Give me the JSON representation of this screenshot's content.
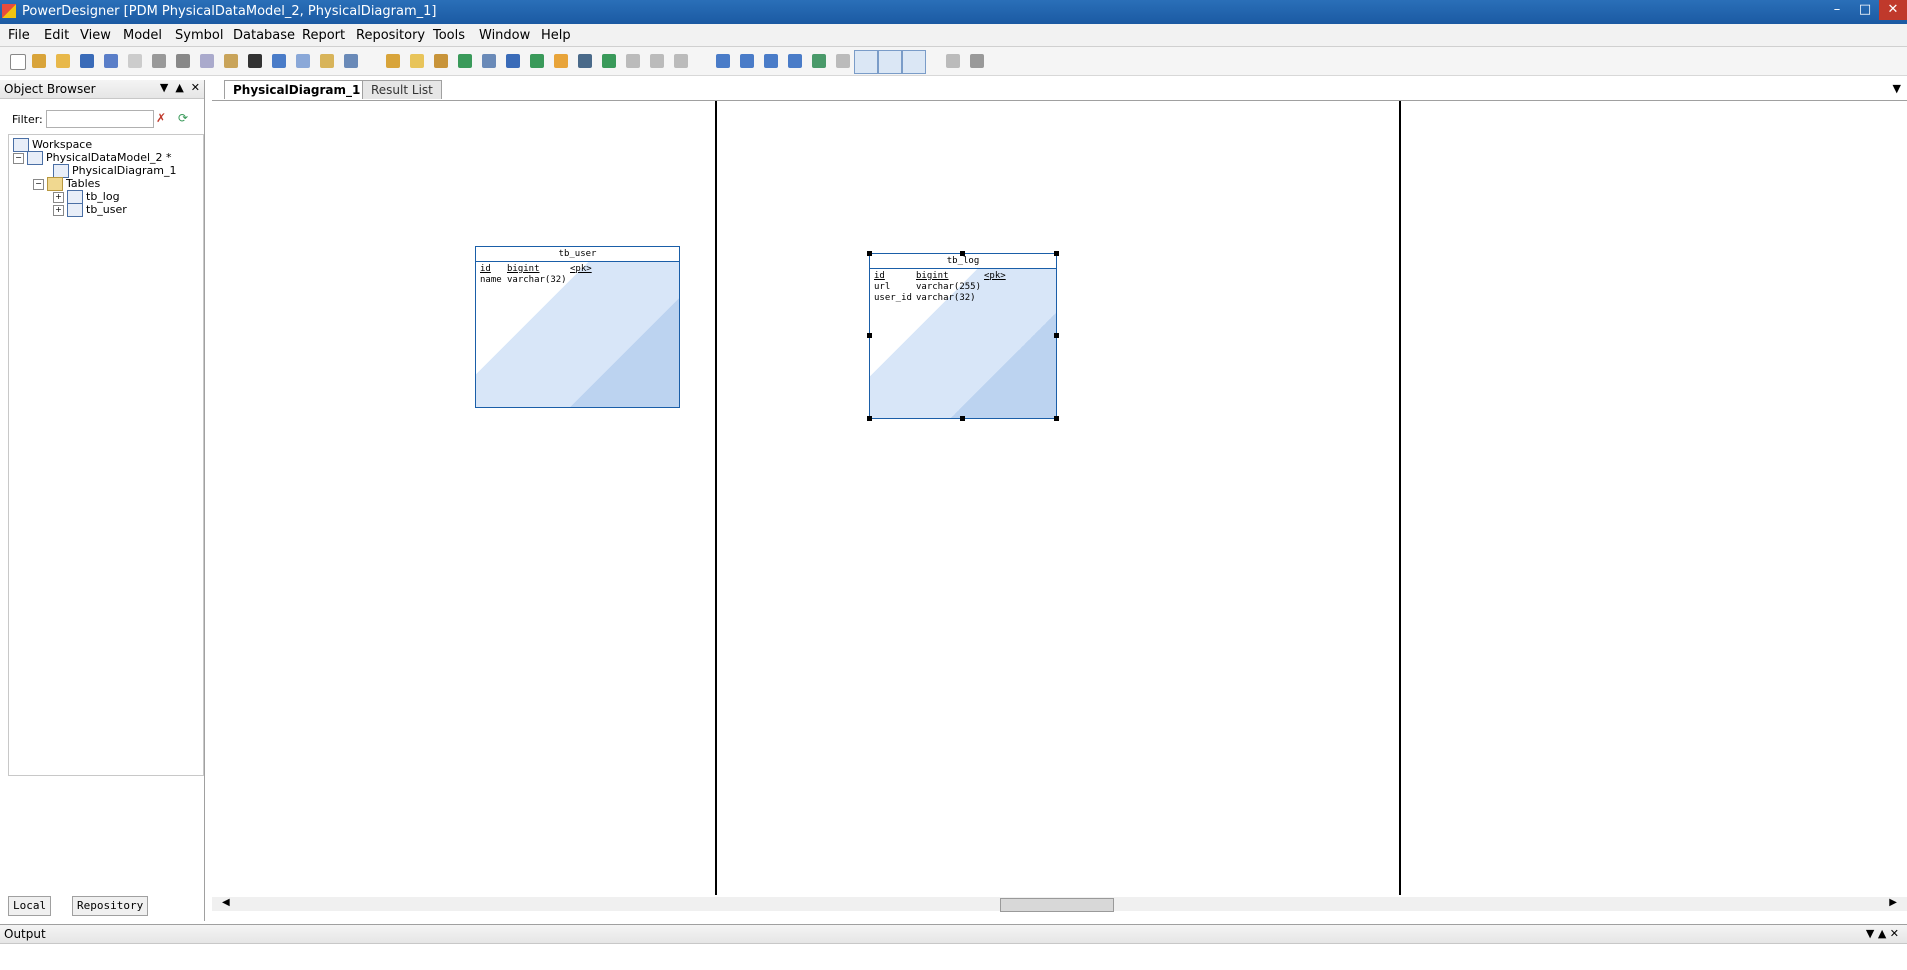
{
  "window": {
    "title": "PowerDesigner [PDM PhysicalDataModel_2, PhysicalDiagram_1]"
  },
  "menu": [
    "File",
    "Edit",
    "View",
    "Model",
    "Symbol",
    "Database",
    "Report",
    "Repository",
    "Tools",
    "Window",
    "Help"
  ],
  "object_browser": {
    "title": "Object Browser",
    "filter_label": "Filter:",
    "filter_value": "",
    "tree": {
      "workspace": "Workspace",
      "model": "PhysicalDataModel_2 *",
      "diagram": "PhysicalDiagram_1",
      "tables_folder": "Tables",
      "tables": [
        "tb_log",
        "tb_user"
      ]
    },
    "footer_tabs": [
      "Local",
      "Repository"
    ]
  },
  "tabs": {
    "active": "PhysicalDiagram_1",
    "inactive": "Result List"
  },
  "diagram": {
    "tables": [
      {
        "name": "tb_user",
        "rows": [
          {
            "col": "id",
            "type": "bigint",
            "key": "<pk>"
          },
          {
            "col": "name",
            "type": "varchar(32)",
            "key": ""
          }
        ]
      },
      {
        "name": "tb_log",
        "rows": [
          {
            "col": "id",
            "type": "bigint",
            "key": "<pk>"
          },
          {
            "col": "url",
            "type": "varchar(255)",
            "key": ""
          },
          {
            "col": "user_id",
            "type": "varchar(32)",
            "key": ""
          }
        ]
      }
    ]
  },
  "output": {
    "title": "Output"
  }
}
